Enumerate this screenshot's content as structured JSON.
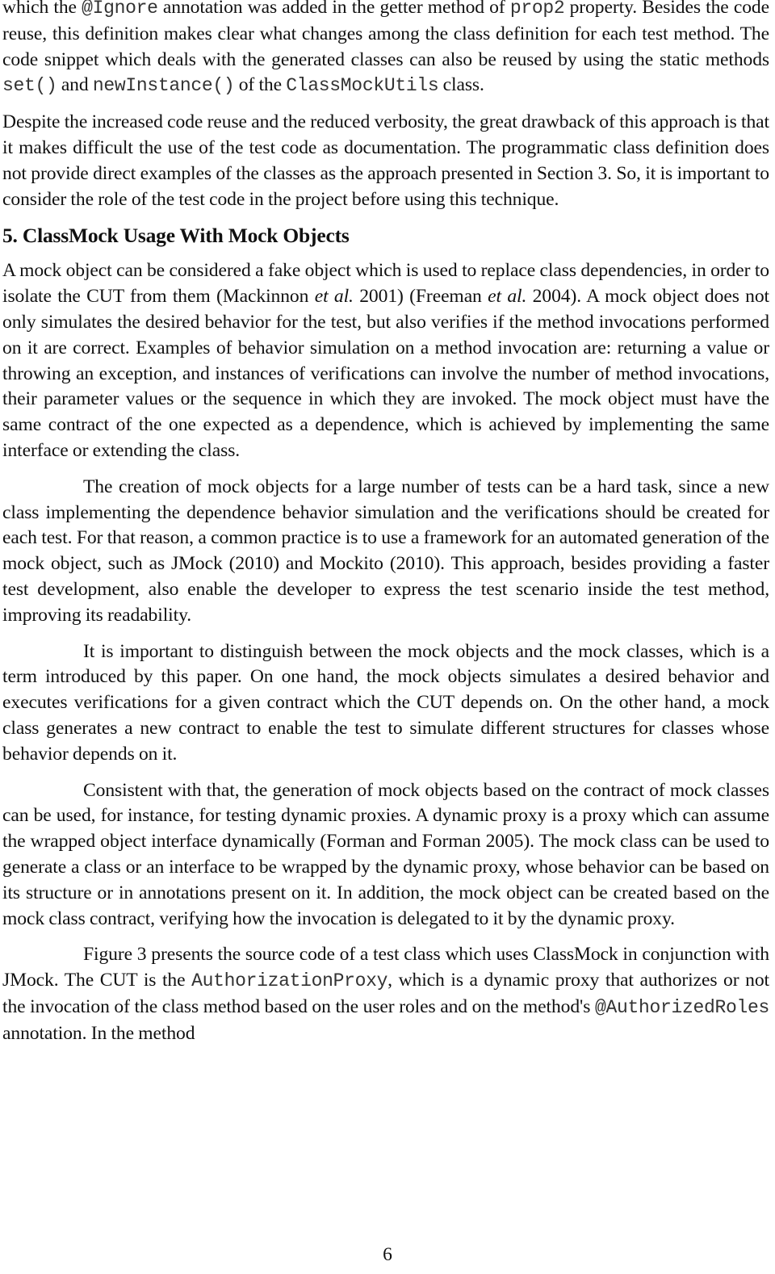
{
  "paragraphs": {
    "p1": {
      "t1": "which the ",
      "c1": "@Ignore",
      "t2": " annotation was added in the getter method of ",
      "c2": "prop2",
      "t3": " property. Besides the code reuse, this definition makes clear what changes among the class definition for each test method. The code snippet which deals with the generated classes can also be reused by using the static methods ",
      "c3": "set()",
      "t4": " and ",
      "c4": "newInstance()",
      "t5": " of the ",
      "c5": "ClassMockUtils",
      "t6": " class."
    },
    "p2": "Despite the increased code reuse and the reduced verbosity, the great drawback of this approach is that it makes difficult the use of the test code as documentation. The programmatic class definition does not provide direct examples of the classes as the approach presented in Section 3. So, it is important to consider the role of the test code in the project before using  this technique.",
    "section_heading": "5. ClassMock Usage With Mock Objects",
    "p3": {
      "t1": "A mock object can be considered a fake object which is used to replace class dependencies, in order to isolate the CUT from them (Mackinnon ",
      "i1": "et al.",
      "t2": " 2001) (Freeman ",
      "i2": "et al.",
      "t3": " 2004). A mock object does not only simulates the desired behavior for the test, but also verifies if the method invocations performed on it are correct. Examples of behavior simulation on a method invocation are: returning a value or throwing an exception, and instances of verifications can involve the number of method invocations, their parameter values or the sequence in which they are invoked. The mock object must have the same contract of the one expected as a dependence, which is achieved by implementing the same interface or extending the class."
    },
    "p4": "The creation of mock objects for a large number of tests can be a hard task, since a new class implementing the dependence behavior simulation and the verifications should be created for each test. For that reason, a common practice is to use a framework for an automated generation of the mock object, such as JMock (2010) and Mockito (2010). This approach, besides providing a faster test development, also enable the developer to express the test scenario inside the test method, improving its readability.",
    "p5": "It is important to distinguish between the mock objects and the mock classes, which is a term introduced by this paper. On one hand, the mock objects simulates a desired behavior and executes verifications for a given contract which the CUT depends on. On the other hand, a mock class generates a new contract to enable the test to simulate different structures for classes whose behavior depends on it.",
    "p6": "Consistent with that, the generation of mock objects based on the contract of mock classes can be used, for instance, for testing dynamic proxies. A dynamic proxy is a proxy which can assume the wrapped object interface dynamically (Forman and Forman 2005). The mock class can be used to generate a class or an interface to be wrapped by the dynamic proxy, whose behavior can be based on its structure or in annotations present on it. In addition,  the mock object can be created based on the mock class contract, verifying how the invocation is delegated to it by the dynamic proxy.",
    "p7": {
      "t1": "Figure 3 presents the source code of a test class which uses ClassMock in conjunction with JMock. The CUT is the ",
      "c1": "AuthorizationProxy",
      "t2": ", which is a dynamic proxy that authorizes or not the invocation of the class method based on the user roles and on the method's ",
      "c2": "@AuthorizedRoles",
      "t3": " annotation. In the method"
    }
  },
  "page_number": "6"
}
